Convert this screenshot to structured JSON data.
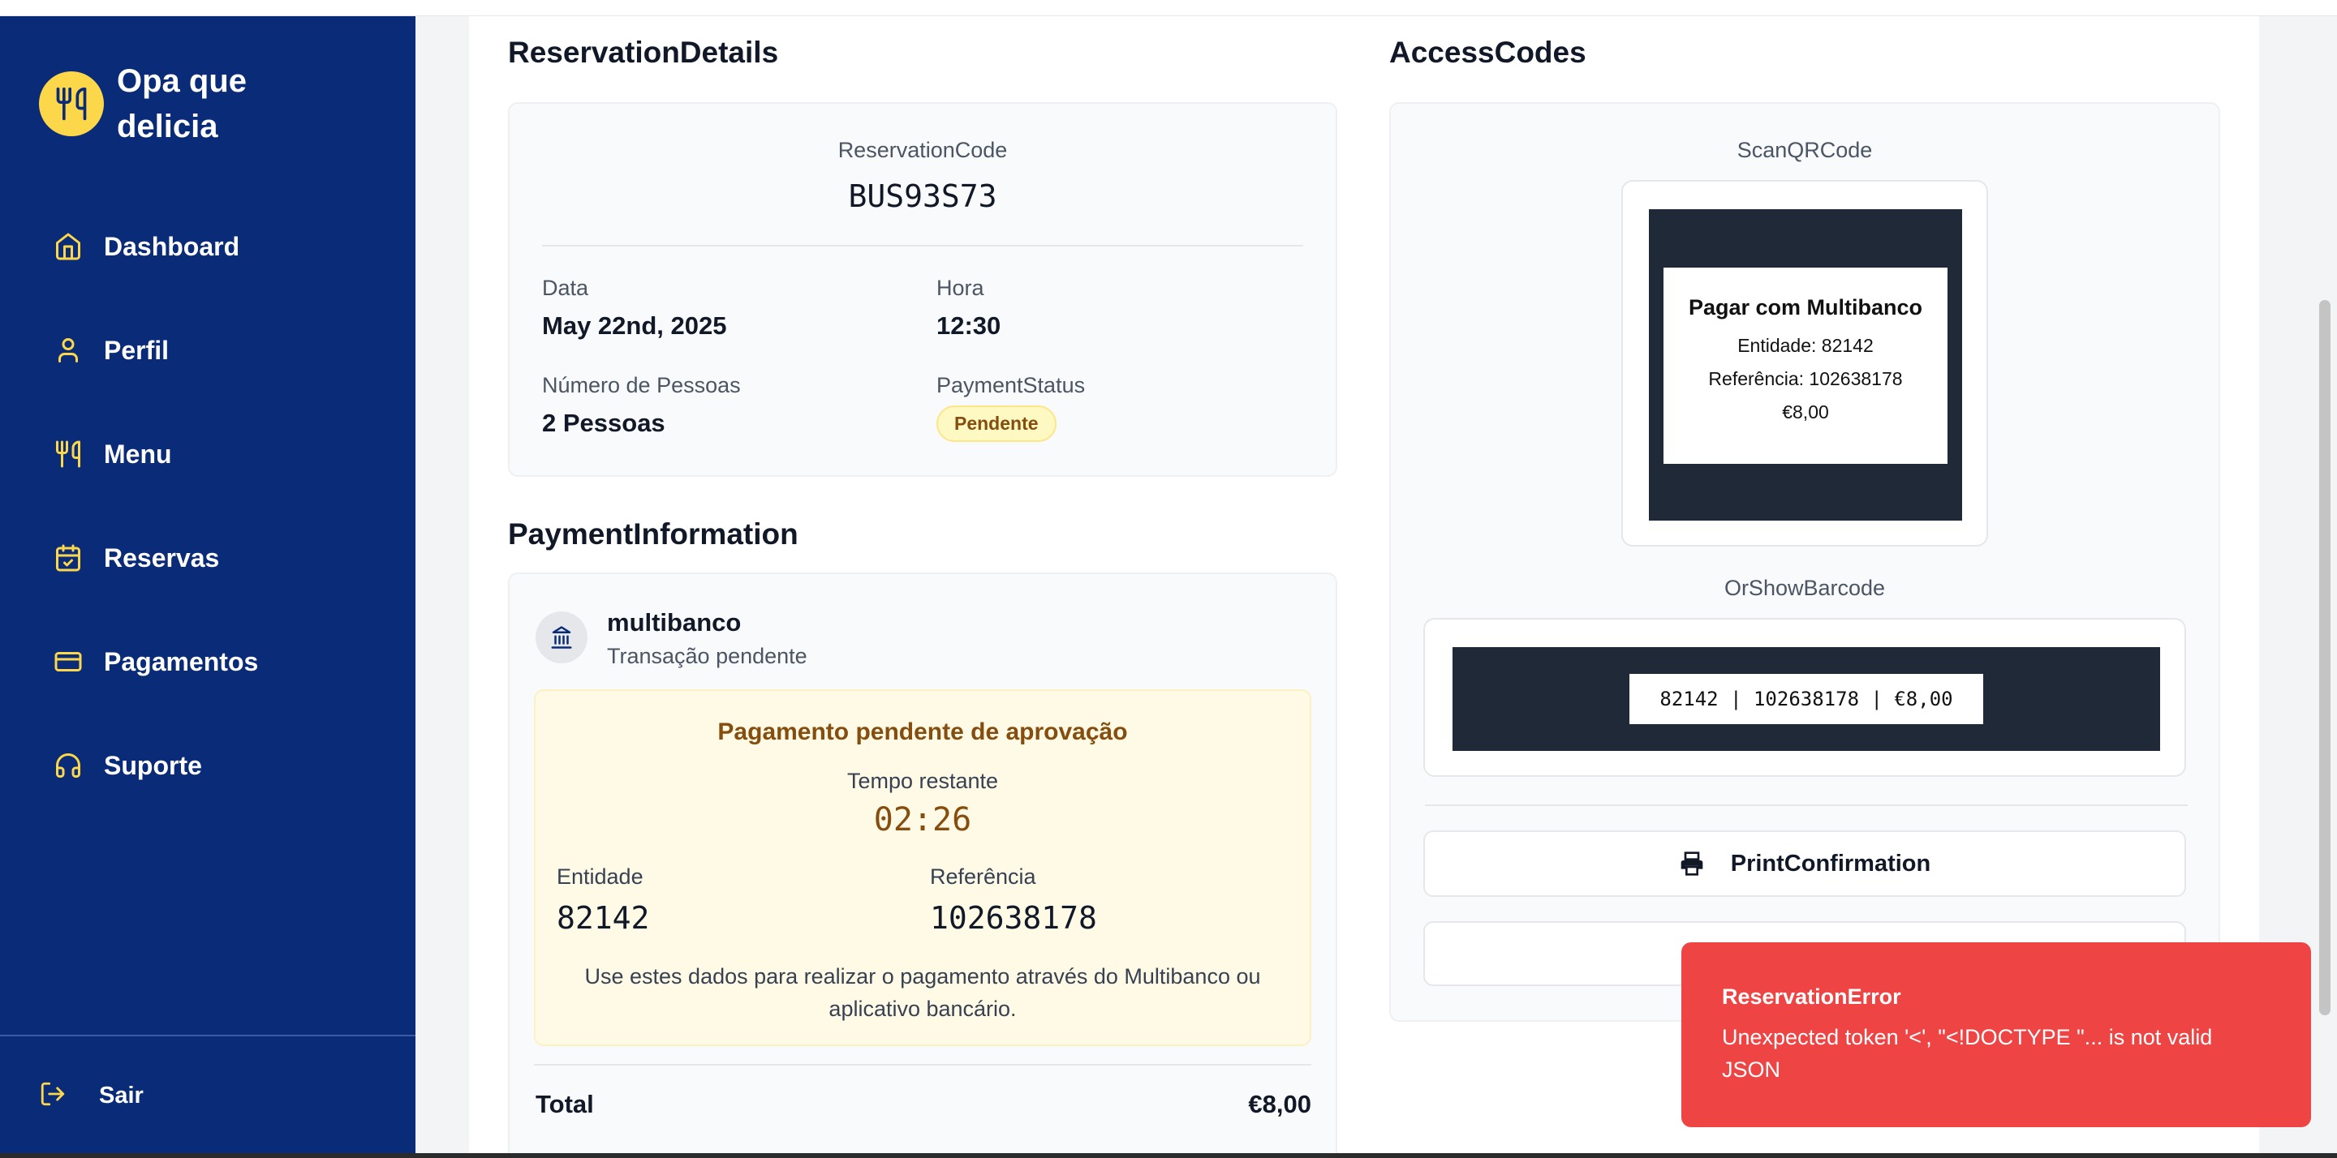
{
  "brand": {
    "name": "Opa que delicia"
  },
  "sidebar": {
    "items": [
      {
        "label": "Dashboard",
        "icon": "home-icon"
      },
      {
        "label": "Perfil",
        "icon": "user-icon"
      },
      {
        "label": "Menu",
        "icon": "utensils-icon"
      },
      {
        "label": "Reservas",
        "icon": "calendar-check-icon"
      },
      {
        "label": "Pagamentos",
        "icon": "credit-card-icon"
      },
      {
        "label": "Suporte",
        "icon": "headset-icon"
      }
    ],
    "logout": "Sair"
  },
  "reservation": {
    "title": "ReservationDetails",
    "code_label": "ReservationCode",
    "code": "BUS93S73",
    "date_label": "Data",
    "date": "May 22nd, 2025",
    "time_label": "Hora",
    "time": "12:30",
    "people_label": "Número de Pessoas",
    "people": "2 Pessoas",
    "status_label": "PaymentStatus",
    "status": "Pendente"
  },
  "payment": {
    "title": "PaymentInformation",
    "method": "multibanco",
    "method_status": "Transação pendente",
    "pending_title": "Pagamento pendente de aprovação",
    "remaining_label": "Tempo restante",
    "remaining": "02:26",
    "entity_label": "Entidade",
    "entity": "82142",
    "reference_label": "Referência",
    "reference": "102638178",
    "instructions": "Use estes dados para realizar o pagamento através do Multibanco ou aplicativo bancário.",
    "total_label": "Total",
    "total": "€8,00"
  },
  "access": {
    "title": "AccessCodes",
    "qr_label": "ScanQRCode",
    "qr_title": "Pagar com Multibanco",
    "qr_entity": "Entidade: 82142",
    "qr_reference": "Referência: 102638178",
    "qr_amount": "€8,00",
    "barcode_label": "OrShowBarcode",
    "barcode_text": "82142 | 102638178 | €8,00",
    "print_label": "PrintConfirmation"
  },
  "toast": {
    "title": "ReservationError",
    "message": "Unexpected token '<', \"<!DOCTYPE \"... is not valid JSON"
  },
  "colors": {
    "sidebar": "#092b78",
    "accent": "#fcd74a",
    "toast": "#ef4444",
    "pending": "#854d0e"
  }
}
